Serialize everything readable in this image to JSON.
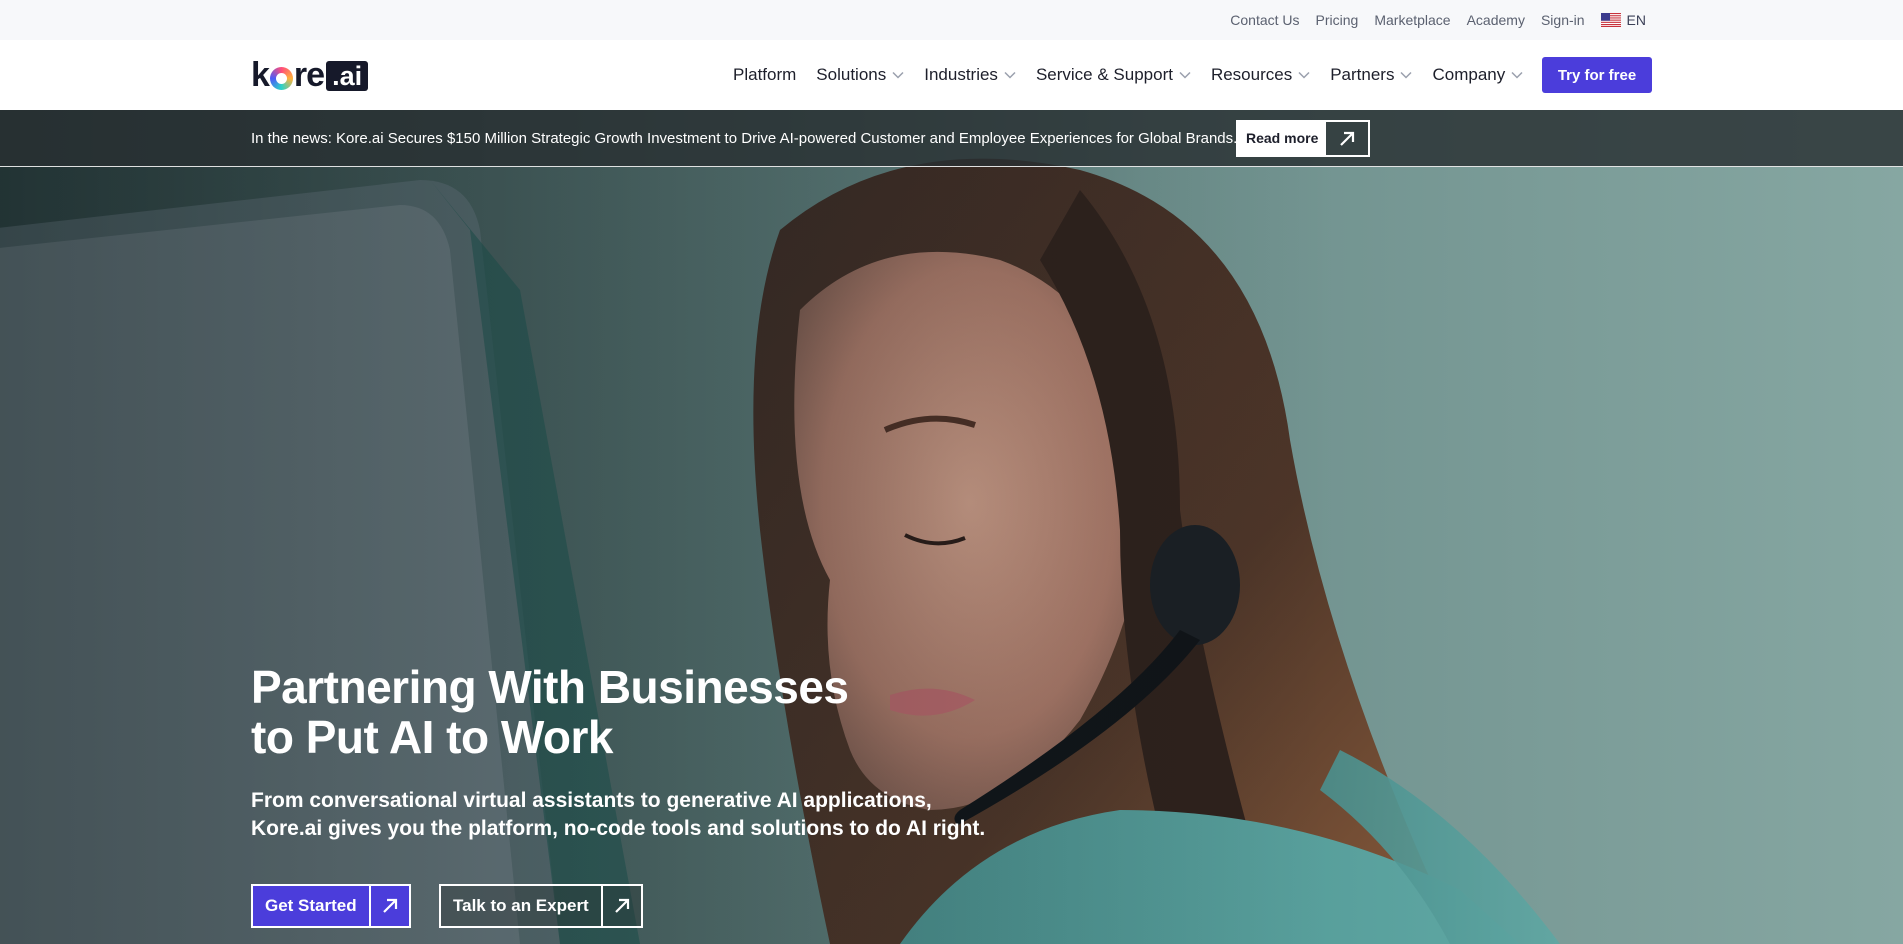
{
  "topbar": {
    "links": [
      "Contact Us",
      "Pricing",
      "Marketplace",
      "Academy",
      "Sign-in"
    ],
    "language": "EN",
    "language_icon": "us-flag-icon"
  },
  "navbar": {
    "logo_text_main": "kre",
    "logo_text_k": "k",
    "logo_text_re": "re",
    "logo_text_ai": ".ai",
    "items": [
      {
        "label": "Platform",
        "has_dropdown": false
      },
      {
        "label": "Solutions",
        "has_dropdown": true
      },
      {
        "label": "Industries",
        "has_dropdown": true
      },
      {
        "label": "Service & Support",
        "has_dropdown": true
      },
      {
        "label": "Resources",
        "has_dropdown": true
      },
      {
        "label": "Partners",
        "has_dropdown": true
      },
      {
        "label": "Company",
        "has_dropdown": true
      }
    ],
    "cta_label": "Try for free"
  },
  "news": {
    "text": "In the news: Kore.ai Secures $150 Million Strategic Growth Investment to Drive AI-powered Customer and Employee Experiences for Global Brands.",
    "button_label": "Read more",
    "button_icon": "arrow-up-right-icon"
  },
  "hero": {
    "headline_line1": "Partnering With Businesses",
    "headline_line2": "to Put AI to Work",
    "subhead_line1": "From conversational virtual assistants to generative AI applications,",
    "subhead_line2": "Kore.ai gives you the platform, no-code tools and solutions to do AI right.",
    "primary_cta": "Get Started",
    "secondary_cta": "Talk to an Expert",
    "image_subject": "customer-service-agent-photo"
  },
  "colors": {
    "brand_primary": "#4b3ddb",
    "text_dark": "#1d1f2b",
    "topbar_bg": "#f7f8fa"
  }
}
